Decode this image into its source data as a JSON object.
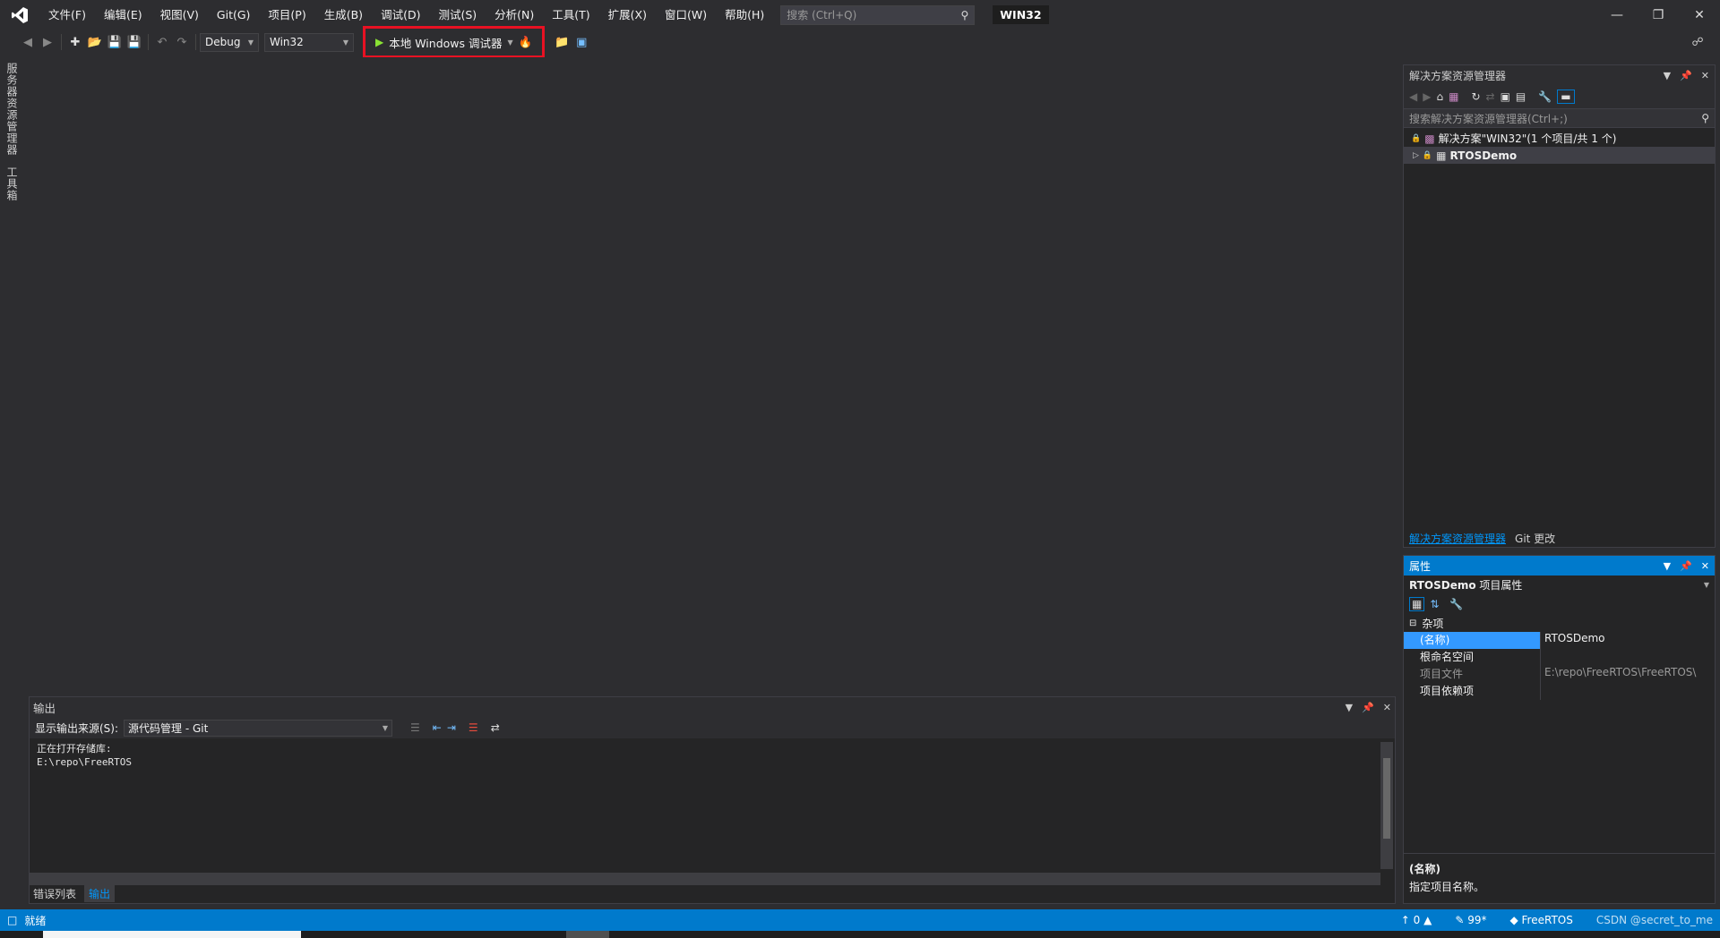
{
  "menu": {
    "items": [
      "文件(F)",
      "编辑(E)",
      "视图(V)",
      "Git(G)",
      "项目(P)",
      "生成(B)",
      "调试(D)",
      "测试(S)",
      "分析(N)",
      "工具(T)",
      "扩展(X)",
      "窗口(W)",
      "帮助(H)"
    ],
    "search_placeholder": "搜索 (Ctrl+Q)",
    "solution_name": "WIN32"
  },
  "toolbar": {
    "config": "Debug",
    "platform": "Win32",
    "run_label": "本地 Windows 调试器"
  },
  "left_rail": {
    "tabs": [
      "服务器资源管理器",
      "工具箱"
    ]
  },
  "output": {
    "title": "输出",
    "source_label": "显示输出来源(S):",
    "source_value": "源代码管理 - Git",
    "lines": [
      "正在打开存储库:",
      "E:\\repo\\FreeRTOS"
    ],
    "tabs": [
      "错误列表",
      "输出"
    ]
  },
  "solution_explorer": {
    "title": "解决方案资源管理器",
    "search_placeholder": "搜索解决方案资源管理器(Ctrl+;)",
    "tree": [
      "解决方案\"WIN32\"(1 个项目/共 1 个)",
      "RTOSDemo"
    ],
    "tabs": [
      "解决方案资源管理器",
      "Git 更改"
    ]
  },
  "properties": {
    "title": "属性",
    "object_name": "RTOSDemo",
    "object_type": "项目属性",
    "category": "杂项",
    "rows": [
      {
        "name": "(名称)",
        "value": "RTOSDemo"
      },
      {
        "name": "根命名空间",
        "value": ""
      },
      {
        "name": "项目文件",
        "value": "E:\\repo\\FreeRTOS\\FreeRTOS\\"
      },
      {
        "name": "项目依赖项",
        "value": ""
      }
    ],
    "desc_title": "(名称)",
    "desc_text": "指定项目名称。"
  },
  "status": {
    "ready": "就绪",
    "up_count": "0",
    "pencil_count": "99*",
    "branch": "FreeRTOS",
    "watermark": "CSDN @secret_to_me"
  },
  "colors": {
    "accent": "#007acc",
    "highlight_box": "#e81123",
    "background": "#2d2d30"
  }
}
